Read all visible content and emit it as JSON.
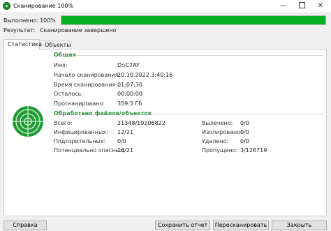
{
  "window": {
    "title": "Сканирование 100%",
    "minimize_glyph": "—",
    "close_glyph": "✕"
  },
  "progress": {
    "label": "Выполнено:",
    "percent_text": "100%",
    "value": 1.0,
    "color": "#06b025"
  },
  "result": {
    "label": "Результат:",
    "value": "Сканирование завершено"
  },
  "tabs": [
    {
      "label": "Статистика",
      "active": true
    },
    {
      "label": "Объекты",
      "active": false
    }
  ],
  "general": {
    "title": "Общая",
    "rows": [
      {
        "key": "Имя:",
        "value": "D:\\C7AY"
      },
      {
        "key": "Начало сканирования:",
        "value": "20.10.2022 3:40:16"
      },
      {
        "key": "Время сканирования:",
        "value": "01:07:30"
      },
      {
        "key": "Осталось:",
        "value": "00:00:00"
      },
      {
        "key": "Просканировано:",
        "value": "359.5 Гб"
      }
    ]
  },
  "processed": {
    "title": "Обработано файлов/объектов",
    "left_rows": [
      {
        "key": "Всего:",
        "value": "21348/19206822"
      },
      {
        "key": "Инфицированных:",
        "value": "12/21"
      },
      {
        "key": "Подозрительных:",
        "value": "0/0"
      },
      {
        "key": "Потенциально опасных:",
        "value": "14/21"
      }
    ],
    "right_rows": [
      {
        "key": "Вылечено:",
        "value": "0/0"
      },
      {
        "key": "Изолировано:",
        "value": "0/0"
      },
      {
        "key": "Удалено:",
        "value": "0/0"
      },
      {
        "key": "Пропущено:",
        "value": "3/126719"
      }
    ]
  },
  "buttons": {
    "help": "Справка",
    "save_report": "Сохранить отчет",
    "rescan": "Пересканировать",
    "close": "Закрыть"
  },
  "colors": {
    "accent": "#2e8b3a",
    "radar": "#1f9a35"
  }
}
